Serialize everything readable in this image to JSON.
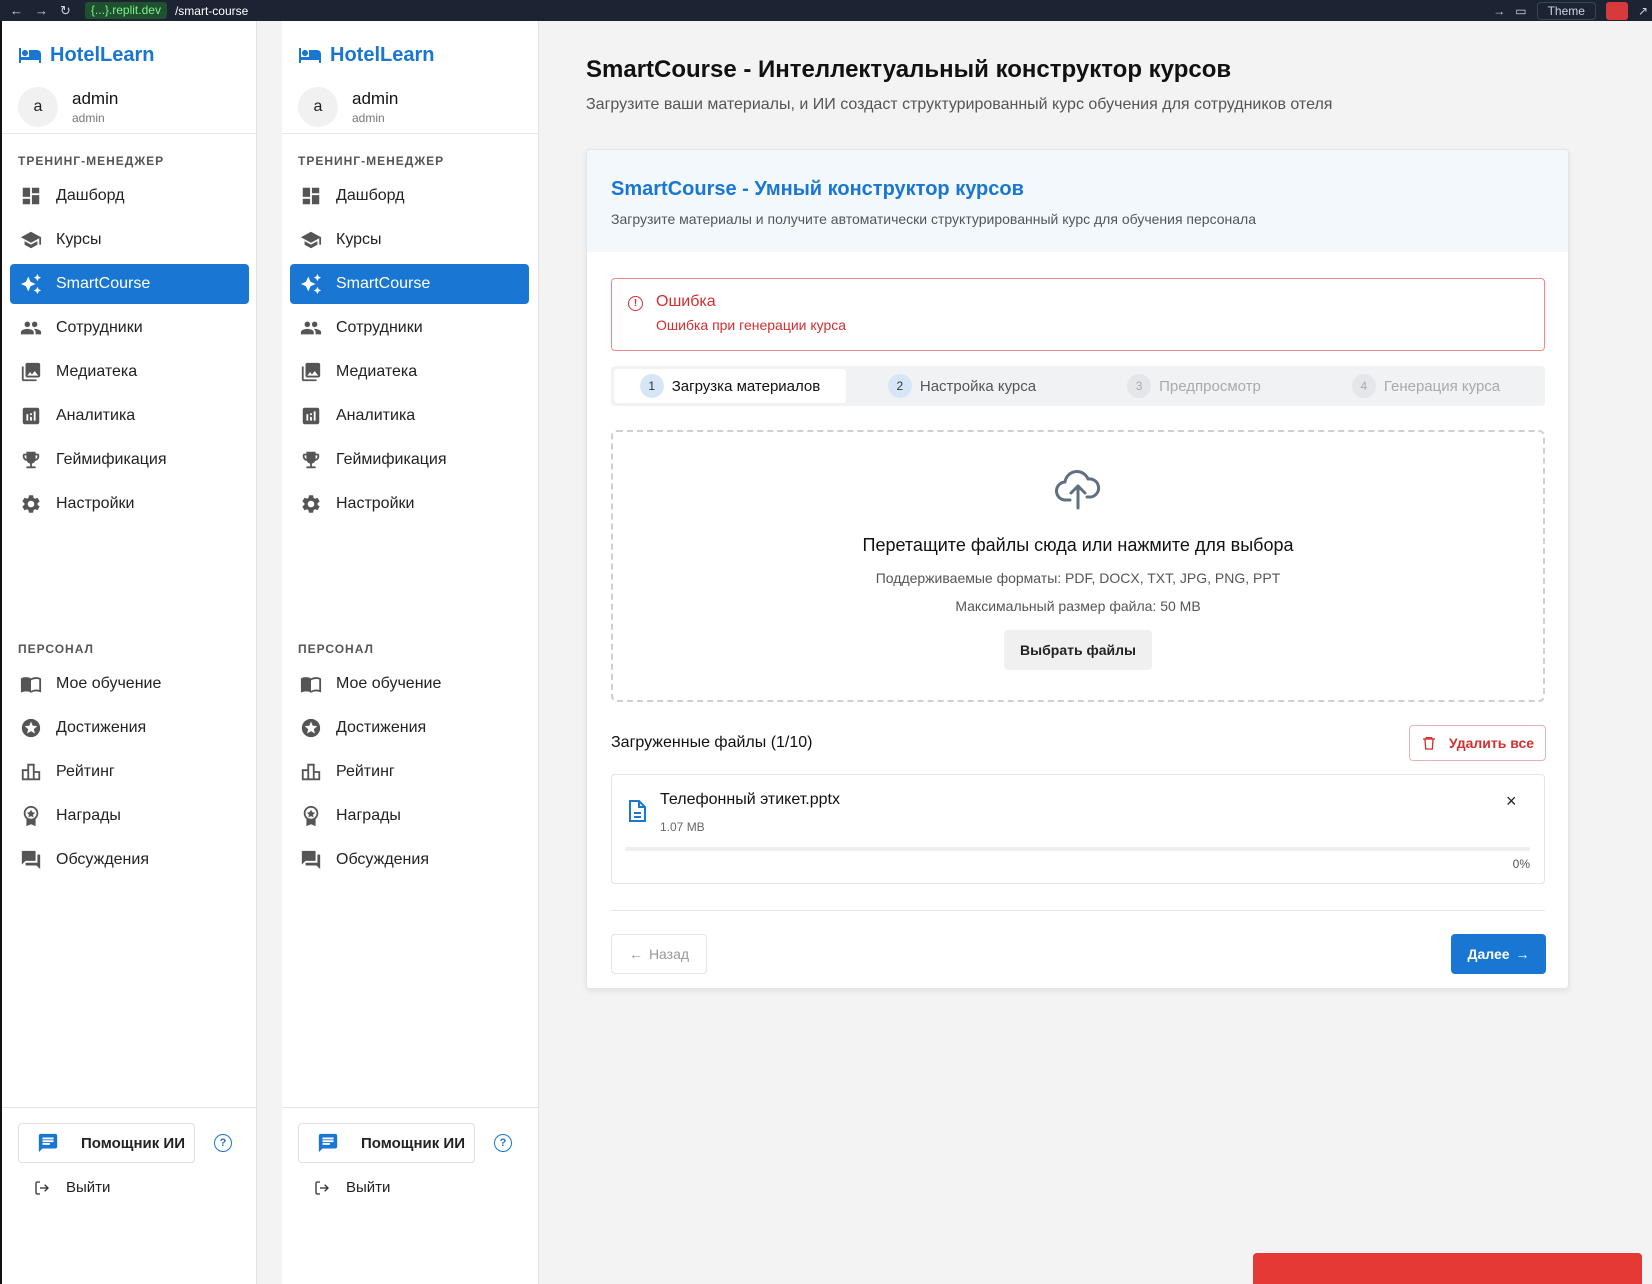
{
  "browser": {
    "host": "{...}.replit.dev",
    "path": "/smart-course",
    "theme_label": "Theme"
  },
  "colors": {
    "accent": "#1976d2",
    "error": "#d32f2f",
    "active_bg": "#1976d2"
  },
  "sidebar": {
    "brand": "HotelLearn",
    "user": {
      "initial": "a",
      "name": "admin",
      "role": "admin"
    },
    "section_manager": "ТРЕНИНГ-МЕНЕДЖЕР",
    "manager_items": [
      {
        "label": "Дашборд",
        "icon": "dashboard-icon"
      },
      {
        "label": "Курсы",
        "icon": "graduation-cap-icon"
      },
      {
        "label": "SmartCourse",
        "icon": "sparkles-icon",
        "active": true
      },
      {
        "label": "Сотрудники",
        "icon": "people-icon"
      },
      {
        "label": "Медиатека",
        "icon": "image-library-icon"
      },
      {
        "label": "Аналитика",
        "icon": "analytics-icon"
      },
      {
        "label": "Геймификация",
        "icon": "trophy-icon"
      },
      {
        "label": "Настройки",
        "icon": "gear-icon"
      }
    ],
    "section_personal": "ПЕРСОНАЛ",
    "personal_items": [
      {
        "label": "Мое обучение",
        "icon": "book-icon"
      },
      {
        "label": "Достижения",
        "icon": "star-badge-icon"
      },
      {
        "label": "Рейтинг",
        "icon": "bar-chart-icon"
      },
      {
        "label": "Награды",
        "icon": "award-icon"
      },
      {
        "label": "Обсуждения",
        "icon": "forum-icon"
      }
    ],
    "assistant_label": "Помощник ИИ",
    "help_glyph": "?",
    "logout_label": "Выйти"
  },
  "main": {
    "title": "SmartCourse - Интеллектуальный конструктор курсов",
    "subtitle": "Загрузите ваши материалы, и ИИ создаст структурированный курс обучения для сотрудников отеля",
    "card": {
      "title": "SmartCourse - Умный конструктор курсов",
      "subtitle": "Загрузите материалы и получите автоматически структурированный курс для обучения персонала",
      "alert": {
        "title": "Ошибка",
        "message": "Ошибка при генерации курса",
        "glyph": "!"
      },
      "steps": [
        {
          "num": "1",
          "label": "Загрузка материалов",
          "state": "active"
        },
        {
          "num": "2",
          "label": "Настройка курса",
          "state": "normal"
        },
        {
          "num": "3",
          "label": "Предпросмотр",
          "state": "disabled"
        },
        {
          "num": "4",
          "label": "Генерация курса",
          "state": "disabled"
        }
      ],
      "dropzone": {
        "title": "Перетащите файлы сюда или нажмите для выбора",
        "formats": "Поддерживаемые форматы: PDF, DOCX, TXT, JPG, PNG, PPT",
        "max_size": "Максимальный размер файла: 50 MB",
        "button": "Выбрать файлы"
      },
      "files_title": "Загруженные файлы (1/10)",
      "delete_all": "Удалить все",
      "file": {
        "name": "Телефонный этикет.pptx",
        "size": "1.07 MB",
        "progress": 0,
        "progress_label": "0%",
        "close_glyph": "×"
      },
      "back_label": "Назад",
      "next_label": "Далее"
    }
  }
}
